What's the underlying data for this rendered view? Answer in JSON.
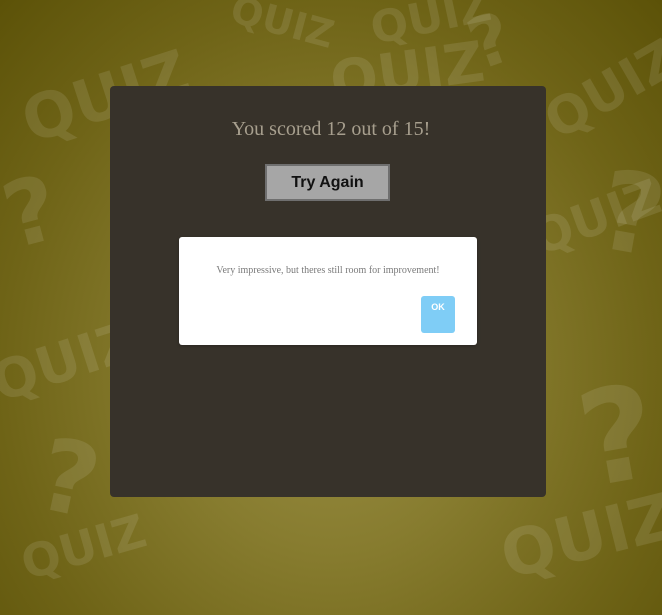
{
  "result": {
    "score_text": "You scored 12 out of 15!",
    "try_again_label": "Try Again"
  },
  "dialog": {
    "message": "Very impressive, but theres still room for improvement!",
    "ok_label": "OK"
  },
  "background": {
    "pattern_word": "QUIZ",
    "pattern_mark": "?",
    "base_color": "#877c2f",
    "panel_color": "#37322a",
    "ok_color": "#7fcdf6"
  }
}
